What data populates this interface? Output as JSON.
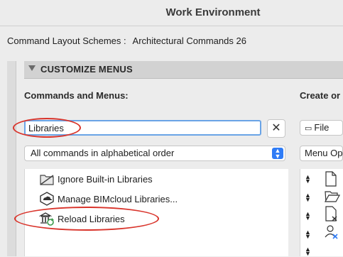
{
  "window": {
    "title": "Work Environment"
  },
  "scheme": {
    "label": "Command Layout Schemes :",
    "value": "Architectural Commands 26"
  },
  "section": {
    "title": "CUSTOMIZE MENUS"
  },
  "left_column": {
    "heading": "Commands and Menus:",
    "search_value": "Libraries",
    "clear_glyph": "✕",
    "filter_selected": "All commands in alphabetical order",
    "items": [
      {
        "label": "Ignore Built-in Libraries",
        "icon": "ignore-libraries-icon"
      },
      {
        "label": "Manage BIMcloud Libraries...",
        "icon": "bimcloud-icon"
      },
      {
        "label": "Reload Libraries",
        "icon": "reload-libraries-icon"
      }
    ]
  },
  "right_column": {
    "heading": "Create or",
    "file_button": "File",
    "menu_options": "Menu Op"
  },
  "annotation_color": "#d9342b"
}
